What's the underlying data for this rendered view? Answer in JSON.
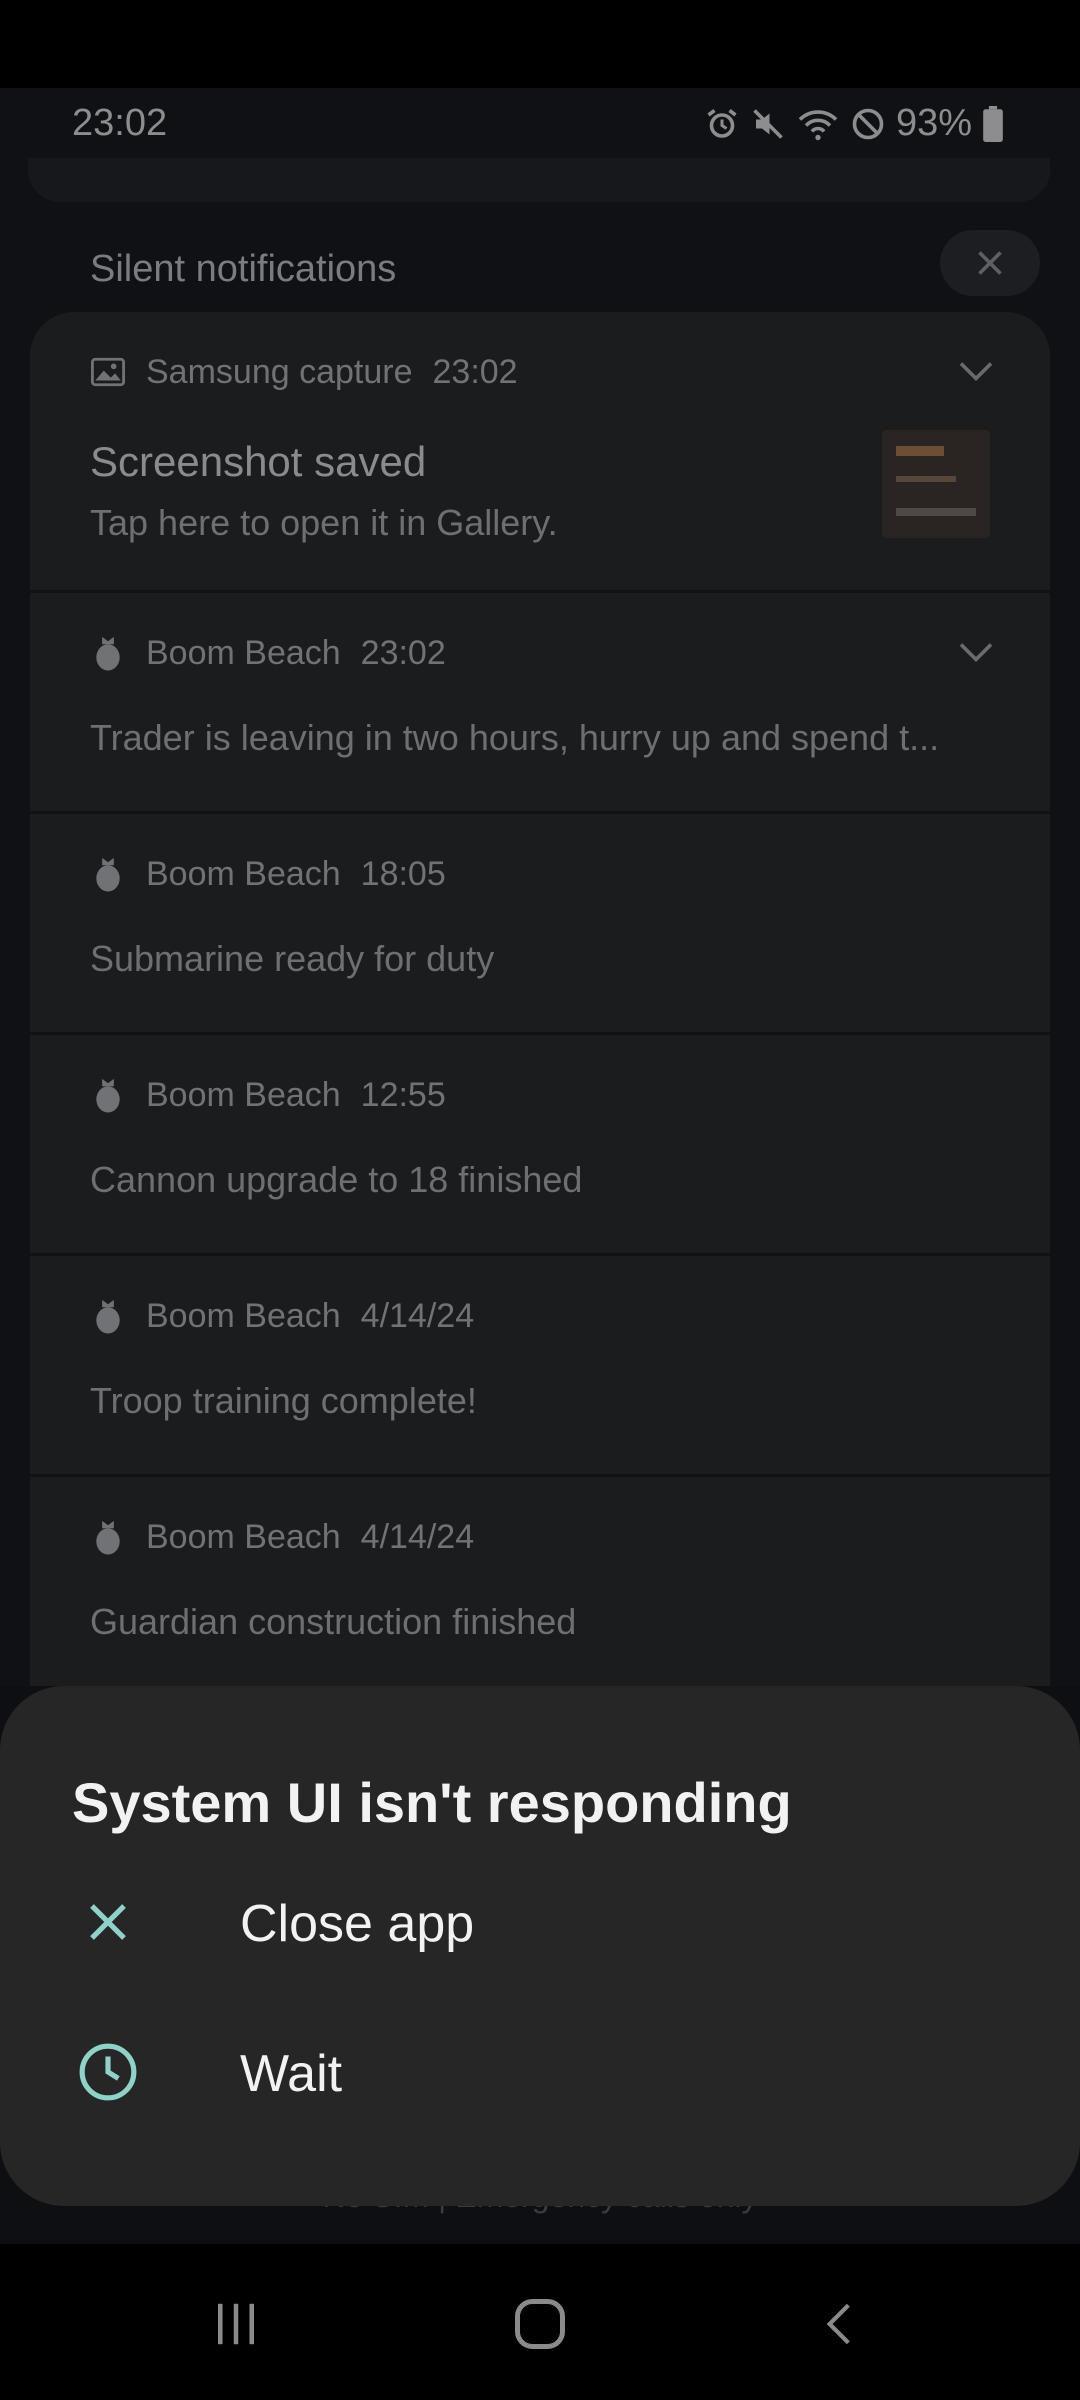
{
  "status_bar": {
    "time": "23:02",
    "battery": "93%",
    "icons": [
      "alarm-icon",
      "mute-icon",
      "wifi-icon",
      "do-not-disturb-icon",
      "battery-icon"
    ]
  },
  "panel": {
    "section_title": "Silent notifications",
    "clear_icon": "close-icon"
  },
  "notifications": [
    {
      "app": "Samsung capture",
      "time": "23:02",
      "icon": "image-icon",
      "title": "Screenshot saved",
      "text": "Tap here to open it in Gallery.",
      "expandable": true,
      "has_thumbnail": true
    },
    {
      "app": "Boom Beach",
      "time": "23:02",
      "icon": "grenade-icon",
      "text": "Trader is leaving in two hours, hurry up and spend t...",
      "expandable": true
    },
    {
      "app": "Boom Beach",
      "time": "18:05",
      "icon": "grenade-icon",
      "text": "Submarine ready for duty"
    },
    {
      "app": "Boom Beach",
      "time": "12:55",
      "icon": "grenade-icon",
      "text": "Cannon upgrade to 18 finished"
    },
    {
      "app": "Boom Beach",
      "time": "4/14/24",
      "icon": "grenade-icon",
      "text": "Troop training complete!"
    },
    {
      "app": "Boom Beach",
      "time": "4/14/24",
      "icon": "grenade-icon",
      "text": "Guardian construction finished"
    }
  ],
  "dialog": {
    "title": "System UI isn't responding",
    "options": [
      {
        "label": "Close app",
        "icon": "close-icon"
      },
      {
        "label": "Wait",
        "icon": "clock-icon"
      }
    ],
    "accent_color": "#8fd3c8"
  },
  "footer_text": "No SIM | Emergency calls only",
  "nav": [
    "recents-button",
    "home-button",
    "back-button"
  ]
}
